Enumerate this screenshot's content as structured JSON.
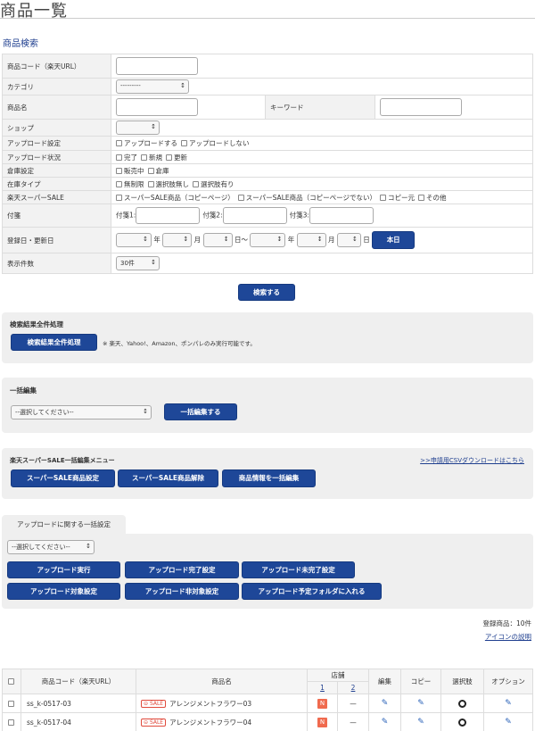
{
  "page_title": "商品一覧",
  "search": {
    "section_title": "商品検索",
    "labels": {
      "code": "商品コード（楽天URL）",
      "category": "カテゴリ",
      "name": "商品名",
      "keyword": "キーワード",
      "shop": "ショップ",
      "upload_setting": "アップロード設定",
      "upload_status": "アップロード状況",
      "warehouse": "倉庫設定",
      "stock_type": "在庫タイプ",
      "rakuten_sale": "楽天スーパーSALE",
      "memo": "付箋",
      "date": "登録日・更新日",
      "display_count": "表示件数"
    },
    "category_value": "---------",
    "upload_setting_opts": [
      "アップロードする",
      "アップロードしない"
    ],
    "upload_status_opts": [
      "完了",
      "新規",
      "更新"
    ],
    "warehouse_opts": [
      "販売中",
      "倉庫"
    ],
    "stock_type_opts": [
      "無制限",
      "選択肢無し",
      "選択肢有り"
    ],
    "sale_opts": [
      "スーパーSALE商品（コピーページ）",
      "スーパーSALE商品（コピーページでない）",
      "コピー元",
      "その他"
    ],
    "memo_labels": [
      "付箋1:",
      "付箋2:",
      "付箋3:"
    ],
    "date_units": {
      "year": "年",
      "month": "月",
      "day": "日",
      "range": "〜"
    },
    "today_button": "本日",
    "display_count_value": "30件",
    "search_button": "検索する"
  },
  "bulk_process": {
    "title": "検索結果全件処理",
    "button": "検索結果全件処理",
    "note": "※ 楽天、Yahoo!、Amazon、ポンパレのみ実行可能です。"
  },
  "bulk_edit": {
    "title": "一括編集",
    "select_value": "--選択してください--",
    "button": "一括編集する"
  },
  "sale_menu": {
    "title": "楽天スーパーSALE一括編集メニュー",
    "csv_link": ">>申請用CSVダウンロードはこちら",
    "buttons": [
      "スーパーSALE商品設定",
      "スーパーSALE商品解除",
      "商品情報を一括編集"
    ]
  },
  "upload_settings": {
    "tab": "アップロードに関する一括設定",
    "select_value": "--選択してください--",
    "buttons": [
      "アップロード実行",
      "アップロード完了設定",
      "アップロード未完了設定",
      "アップロード対象設定",
      "アップロード非対象設定",
      "アップロード予定フォルダに入れる"
    ]
  },
  "summary": {
    "count": "登録商品：10件",
    "icon_help": "アイコンの説明"
  },
  "table": {
    "headers": {
      "code": "商品コード（楽天URL）",
      "name": "商品名",
      "shop": "店舗",
      "shop1": "1",
      "shop2": "2",
      "edit": "編集",
      "copy": "コピー",
      "choice": "選択肢",
      "option": "オプション"
    },
    "rows": [
      {
        "code": "ss_k-0517-03",
        "badge": "SALE",
        "name": "アレンジメントフラワー03",
        "shop1": "N",
        "shop2": "—"
      },
      {
        "code": "ss_k-0517-04",
        "badge": "SALE",
        "name": "アレンジメントフラワー04",
        "shop1": "N",
        "shop2": "—"
      }
    ]
  }
}
